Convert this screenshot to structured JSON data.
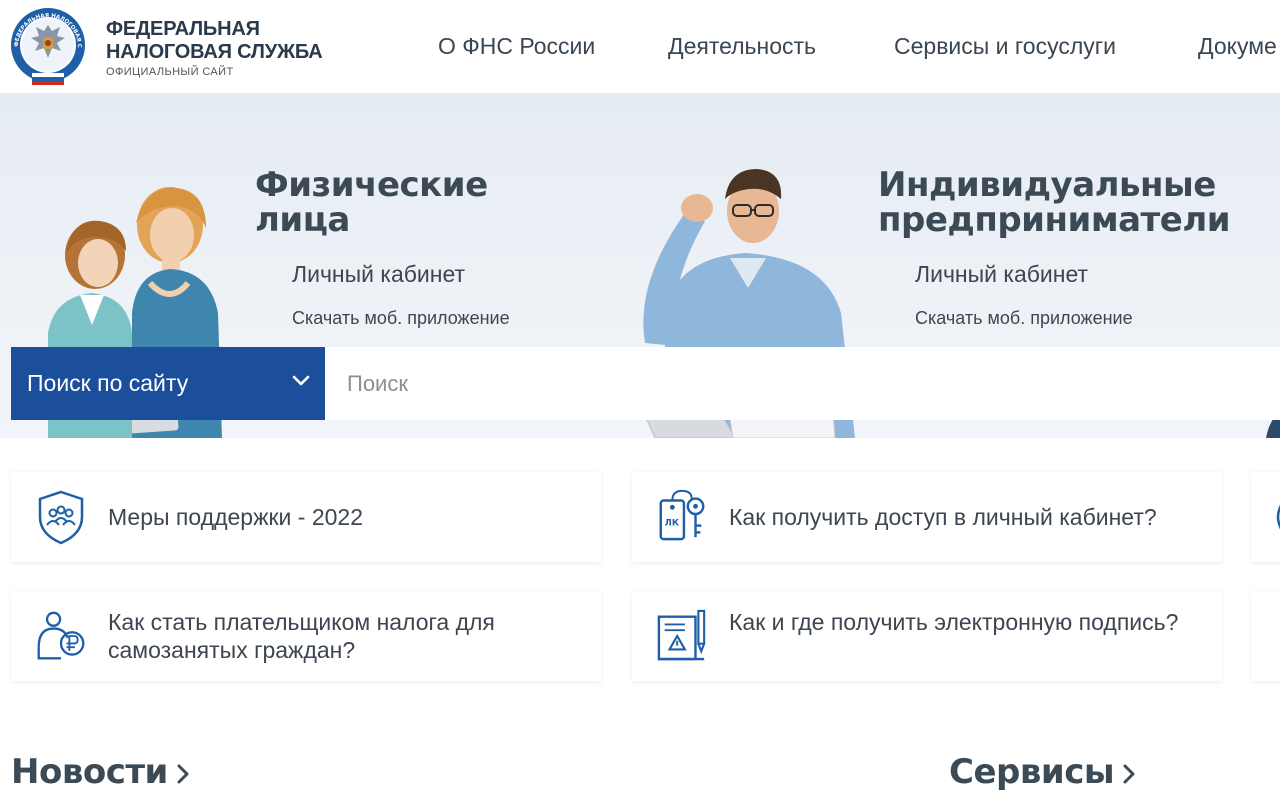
{
  "header": {
    "logo": {
      "line1": "ФЕДЕРАЛЬНАЯ",
      "line2": "НАЛОГОВАЯ СЛУЖБА",
      "subtitle": "ОФИЦИАЛЬНЫЙ САЙТ",
      "emblem_text": "ФЕДЕРАЛЬНАЯ НАЛОГОВАЯ СЛУЖБА"
    },
    "nav": [
      {
        "label": "О ФНС России"
      },
      {
        "label": "Деятельность"
      },
      {
        "label": "Сервисы и госуслуги"
      },
      {
        "label": "Докуме"
      }
    ]
  },
  "hero": {
    "individuals": {
      "title_line1": "Физические",
      "title_line2": "лица",
      "cabinet_link": "Личный кабинет",
      "app_link": "Скачать моб. приложение"
    },
    "entrepreneurs": {
      "title_line1": "Индивидуальные",
      "title_line2": "предприниматели",
      "cabinet_link": "Личный кабинет",
      "app_link": "Скачать моб. приложение"
    }
  },
  "search": {
    "scope_label": "Поиск по сайту",
    "placeholder": "Поиск"
  },
  "quick_links": [
    {
      "text": "Меры поддержки - 2022",
      "icon": "shield-people-icon"
    },
    {
      "text": "Как получить доступ в личный кабинет?",
      "icon": "key-tag-icon",
      "icon_text": "ЛК"
    },
    {
      "text": "Как стать плательщиком налога для самозанятых граждан?",
      "icon": "person-ruble-icon"
    },
    {
      "text": "Как и где получить электронную подпись?",
      "icon": "document-pen-icon"
    }
  ],
  "sections": {
    "news": "Новости",
    "services": "Сервисы"
  },
  "colors": {
    "primary_blue": "#1b4f9c",
    "icon_blue": "#1f5fa8",
    "hero_bg": "#e6ecf3",
    "heading": "#3c4a55"
  }
}
